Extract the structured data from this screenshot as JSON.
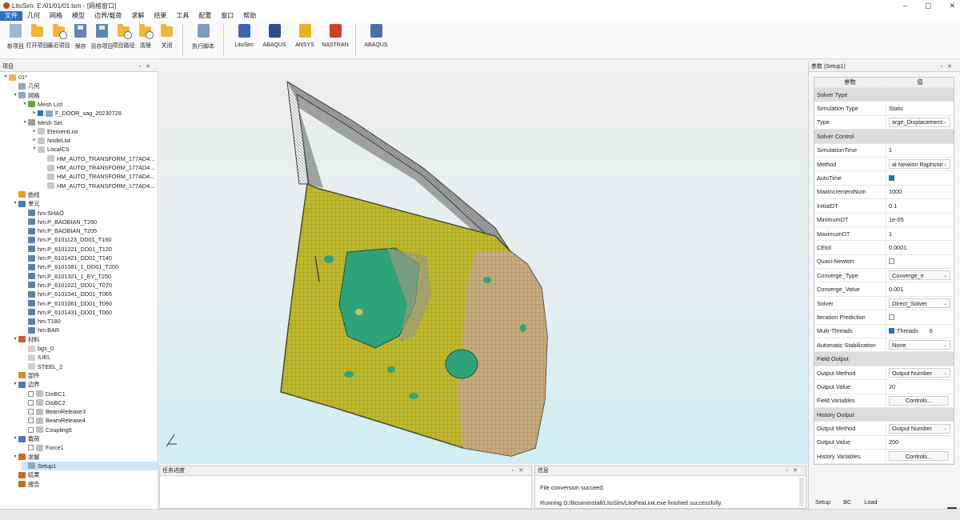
{
  "window": {
    "title": "LitoSim: E:/01/01/01.lsm - [网格窗口]"
  },
  "menu": [
    "文件",
    "几何",
    "网格",
    "模型",
    "边界/载荷",
    "求解",
    "结果",
    "工具",
    "配置",
    "窗口",
    "帮助"
  ],
  "ribbon": {
    "group1": [
      "新项目",
      "打开项目",
      "最近项目",
      "保存",
      "另存项目",
      "项目路径",
      "清理",
      "关闭"
    ],
    "group2": [
      "执行脚本"
    ],
    "group3": [
      "LitoSim",
      "ABAQUS",
      "ANSYS",
      "NASTRAN"
    ],
    "group4": [
      "ABAQUS"
    ]
  },
  "tree": {
    "title": "项目",
    "rows": [
      {
        "label": "01*",
        "ind": 0,
        "tw": "v",
        "icon": "#e9b84a"
      },
      {
        "label": "几何",
        "ind": 1,
        "tw": "",
        "icon": "#8aa7c7"
      },
      {
        "label": "网格",
        "ind": 1,
        "tw": "v",
        "icon": "#8aa7c7"
      },
      {
        "label": "Mesh List",
        "ind": 2,
        "tw": "v",
        "icon": "#6fa24b"
      },
      {
        "label": "F_DOOR_sag_20230728",
        "ind": 3,
        "tw": ">",
        "icon": "#8aa7c7",
        "cb": "on"
      },
      {
        "label": "Mesh Set",
        "ind": 2,
        "tw": "v",
        "icon": "#9a9a9a"
      },
      {
        "label": "ElementList",
        "ind": 3,
        "tw": ">",
        "icon": "#c8c8c8"
      },
      {
        "label": "NodeList",
        "ind": 3,
        "tw": ">",
        "icon": "#c8c8c8"
      },
      {
        "label": "LocalCS",
        "ind": 3,
        "tw": "v",
        "icon": "#c8c8c8"
      },
      {
        "label": "HM_AUTO_TRANSFORM_177AD4...",
        "ind": 4,
        "tw": "",
        "icon": "#c8c8c8"
      },
      {
        "label": "HM_AUTO_TRANSFORM_177AD4...",
        "ind": 4,
        "tw": "",
        "icon": "#c8c8c8"
      },
      {
        "label": "HM_AUTO_TRANSFORM_177AD4...",
        "ind": 4,
        "tw": "",
        "icon": "#c8c8c8"
      },
      {
        "label": "HM_AUTO_TRANSFORM_177AD4...",
        "ind": 4,
        "tw": "",
        "icon": "#c8c8c8"
      },
      {
        "label": "曲线",
        "ind": 1,
        "tw": "",
        "icon": "#e0a020"
      },
      {
        "label": "单元",
        "ind": 1,
        "tw": "v",
        "icon": "#4a7ab0"
      },
      {
        "label": "hm.SHAO",
        "ind": 2,
        "tw": "",
        "icon": "#5c7fae"
      },
      {
        "label": "hm.P_BAOBIAN_T260",
        "ind": 2,
        "tw": "",
        "icon": "#5c7fae"
      },
      {
        "label": "hm.P_BAOBIAN_T205",
        "ind": 2,
        "tw": "",
        "icon": "#5c7fae"
      },
      {
        "label": "hm.P_6101123_DD01_T160",
        "ind": 2,
        "tw": "",
        "icon": "#5c7fae"
      },
      {
        "label": "hm.P_6101221_DD01_T120",
        "ind": 2,
        "tw": "",
        "icon": "#5c7fae"
      },
      {
        "label": "hm.P_6101421_DD01_T140",
        "ind": 2,
        "tw": "",
        "icon": "#5c7fae"
      },
      {
        "label": "hm.P_6101081_1_DD01_T200",
        "ind": 2,
        "tw": "",
        "icon": "#5c7fae"
      },
      {
        "label": "hm.P_6101321_1_EY_T250",
        "ind": 2,
        "tw": "",
        "icon": "#5c7fae"
      },
      {
        "label": "hm.P_6101021_DD01_T070",
        "ind": 2,
        "tw": "",
        "icon": "#5c7fae"
      },
      {
        "label": "hm.P_6101041_DD01_T065",
        "ind": 2,
        "tw": "",
        "icon": "#5c7fae"
      },
      {
        "label": "hm.P_6101061_DD01_T090",
        "ind": 2,
        "tw": "",
        "icon": "#5c7fae"
      },
      {
        "label": "hm.P_6101431_DD01_T060",
        "ind": 2,
        "tw": "",
        "icon": "#5c7fae"
      },
      {
        "label": "hm.T180",
        "ind": 2,
        "tw": "",
        "icon": "#5c7fae"
      },
      {
        "label": "hm.BAR",
        "ind": 2,
        "tw": "",
        "icon": "#5c7fae"
      },
      {
        "label": "材料",
        "ind": 1,
        "tw": "v",
        "icon": "#c0603a"
      },
      {
        "label": "bgs_0",
        "ind": 2,
        "tw": "",
        "icon": "#d0d0d0"
      },
      {
        "label": "IUEL",
        "ind": 2,
        "tw": "",
        "icon": "#d0d0d0"
      },
      {
        "label": "STEEL_2",
        "ind": 2,
        "tw": "",
        "icon": "#d0d0d0"
      },
      {
        "label": "部件",
        "ind": 1,
        "tw": "",
        "icon": "#e08a20"
      },
      {
        "label": "边界",
        "ind": 1,
        "tw": "v",
        "icon": "#4a7ab0"
      },
      {
        "label": "DisBC1",
        "ind": 2,
        "tw": "",
        "icon": "#bfbfbf",
        "cb": "off"
      },
      {
        "label": "DisBC2",
        "ind": 2,
        "tw": "",
        "icon": "#bfbfbf",
        "cb": "off"
      },
      {
        "label": "BeamRelease3",
        "ind": 2,
        "tw": "",
        "icon": "#bfbfbf",
        "cb": "off"
      },
      {
        "label": "BeamRelease4",
        "ind": 2,
        "tw": "",
        "icon": "#bfbfbf",
        "cb": "off"
      },
      {
        "label": "Coupling5",
        "ind": 2,
        "tw": "",
        "icon": "#bfbfbf",
        "cb": "off"
      },
      {
        "label": "载荷",
        "ind": 1,
        "tw": "v",
        "icon": "#4a7ab0"
      },
      {
        "label": "Force1",
        "ind": 2,
        "tw": "",
        "icon": "#bfbfbf",
        "cb": "off"
      },
      {
        "label": "求解",
        "ind": 1,
        "tw": "v",
        "icon": "#c07020"
      },
      {
        "label": "Setup1",
        "ind": 2,
        "tw": "",
        "icon": "#8aa7c7",
        "sel": true
      },
      {
        "label": "结果",
        "ind": 1,
        "tw": "",
        "icon": "#c07020"
      },
      {
        "label": "报告",
        "ind": 1,
        "tw": "",
        "icon": "#c07020"
      }
    ]
  },
  "task_panel": {
    "title": "任务进度"
  },
  "message_panel": {
    "title": "信息",
    "lines": [
      "File conversion succeed.",
      "Running D:/litosiminstall/LitoSim/LitoFeaLink.exe finished successfully."
    ]
  },
  "params": {
    "title": "参数 (Setup1)",
    "col_key": "参数",
    "col_val": "值",
    "rows": [
      {
        "t": "sec",
        "k": "Solver Type"
      },
      {
        "t": "text",
        "k": "Simulation Type",
        "v": "Static"
      },
      {
        "t": "combo",
        "k": "Type",
        "v": "arge_Displacement"
      },
      {
        "t": "sec",
        "k": "Solver Control"
      },
      {
        "t": "text",
        "k": "SimulationTime",
        "v": "1"
      },
      {
        "t": "combo",
        "k": "Method",
        "v": "al Newton Raphson"
      },
      {
        "t": "check",
        "k": "AutoTime",
        "v": "on"
      },
      {
        "t": "text",
        "k": "MaxIncrementNum",
        "v": "1000"
      },
      {
        "t": "text",
        "k": "InitialDT",
        "v": "0.1"
      },
      {
        "t": "text",
        "k": "MinimumDT",
        "v": "1e-05"
      },
      {
        "t": "text",
        "k": "MaximumDT",
        "v": "1"
      },
      {
        "t": "text",
        "k": "CEtol",
        "v": "0.0001"
      },
      {
        "t": "check",
        "k": "Quasi-Newton",
        "v": "off"
      },
      {
        "t": "combo",
        "k": "Converge_Type",
        "v": "Converge_e"
      },
      {
        "t": "text",
        "k": "Converge_Value",
        "v": "0.001"
      },
      {
        "t": "combo",
        "k": "Solver",
        "v": "Direct_Solver"
      },
      {
        "t": "check",
        "k": "Iteration Prediction",
        "v": "off"
      },
      {
        "t": "threads",
        "k": "Multi-Threads",
        "v": "on",
        "label": "Threads",
        "n": "6"
      },
      {
        "t": "combo",
        "k": "Automatic Stabilization",
        "v": "None"
      },
      {
        "t": "sec",
        "k": "Field Output"
      },
      {
        "t": "combo",
        "k": "Output Method",
        "v": "Output Number"
      },
      {
        "t": "text",
        "k": "Output Value",
        "v": "20"
      },
      {
        "t": "btn",
        "k": "Field Variables",
        "v": "Controls..."
      },
      {
        "t": "sec",
        "k": "History Output"
      },
      {
        "t": "combo",
        "k": "Output Method",
        "v": "Output Number"
      },
      {
        "t": "text",
        "k": "Output Value",
        "v": "200"
      },
      {
        "t": "btn",
        "k": "History Variables",
        "v": "Controls..."
      }
    ],
    "tabs": [
      "Setup",
      "BC",
      "Load"
    ]
  },
  "colors": {
    "accent": "#2f6fbf",
    "mesh_yellow": "#bfba2a",
    "mesh_green": "#2ea37a",
    "mesh_tan": "#c9a88e",
    "mesh_edge": "#4a4a30"
  }
}
